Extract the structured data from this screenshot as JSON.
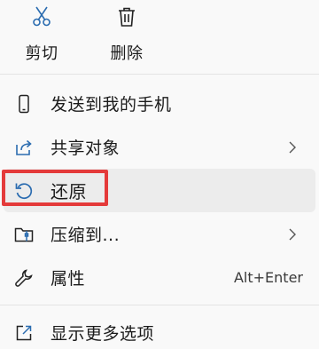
{
  "top_actions": {
    "cut_label": "剪切",
    "delete_label": "删除"
  },
  "menu": {
    "items": [
      {
        "label": "发送到我的手机",
        "icon": "phone-icon"
      },
      {
        "label": "共享对象",
        "icon": "share-icon",
        "has_submenu": true
      },
      {
        "label": "还原",
        "icon": "restore-icon",
        "highlighted": true
      },
      {
        "label": "压缩到...",
        "icon": "archive-folder-icon",
        "has_submenu": true
      },
      {
        "label": "属性",
        "icon": "wrench-icon",
        "shortcut": "Alt+Enter"
      },
      {
        "label": "显示更多选项",
        "icon": "more-options-icon"
      }
    ]
  },
  "colors": {
    "accent_icon": "#2b6cb0",
    "highlight_border": "#e43a3a"
  }
}
